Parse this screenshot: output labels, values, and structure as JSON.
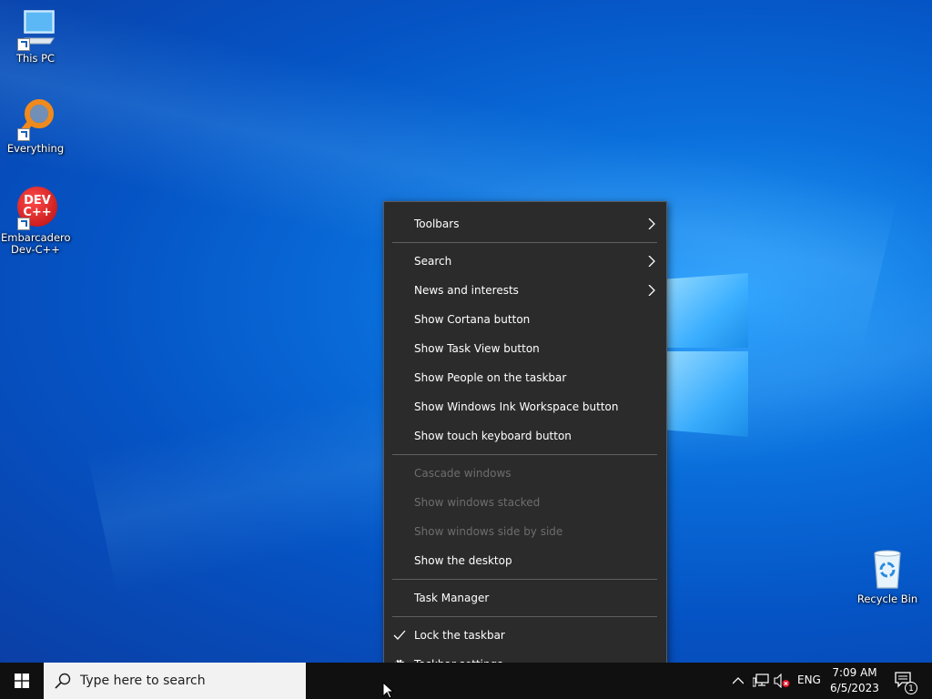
{
  "desktop": {
    "icons": [
      {
        "label": "This PC",
        "icon": "this-pc-icon"
      },
      {
        "label": "Everything",
        "icon": "everything-search-icon"
      },
      {
        "label_line1": "Embarcadero",
        "label_line2": "Dev-C++",
        "badge": "DEV C++",
        "icon": "devcpp-icon"
      },
      {
        "label": "Recycle Bin",
        "icon": "recycle-bin-icon"
      }
    ]
  },
  "context_menu": {
    "toolbars": "Toolbars",
    "search": "Search",
    "news": "News and interests",
    "cortana": "Show Cortana button",
    "task_view": "Show Task View button",
    "people": "Show People on the taskbar",
    "ink": "Show Windows Ink Workspace button",
    "touch_keyboard": "Show touch keyboard button",
    "cascade": "Cascade windows",
    "stacked": "Show windows stacked",
    "side_by_side": "Show windows side by side",
    "show_desktop": "Show the desktop",
    "task_manager": "Task Manager",
    "lock_taskbar": "Lock the taskbar",
    "taskbar_settings": "Taskbar settings"
  },
  "taskbar": {
    "search_placeholder": "Type here to search",
    "language": "ENG",
    "time": "7:09 AM",
    "date": "6/5/2023",
    "notification_count": "1"
  },
  "colors": {
    "menu_bg": "#2b2b2b",
    "menu_disabled": "#6d6d6d",
    "taskbar_bg": "#101010",
    "desktop_accent": "#0a6fdb"
  }
}
